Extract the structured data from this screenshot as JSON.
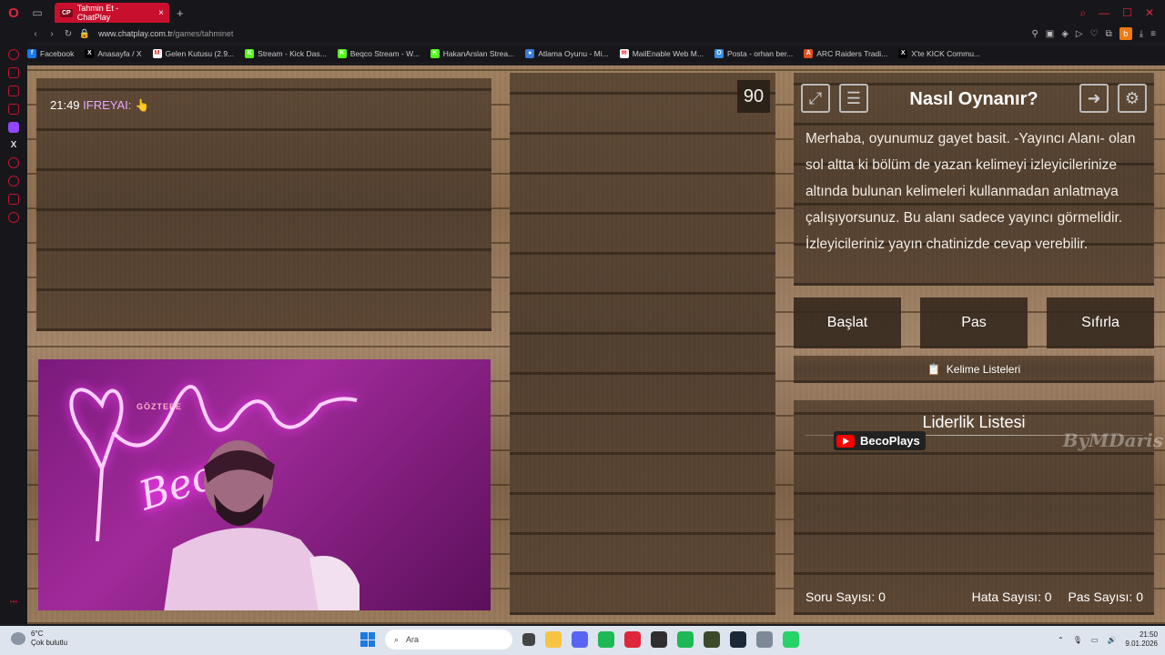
{
  "browser": {
    "tab_title": "Tahmin Et - ChatPlay",
    "tab_favicon": "CP",
    "url_host": "www.chatplay.com.tr",
    "url_path": "/games/tahminet",
    "extension_letter": "b",
    "bookmarks": [
      {
        "label": "Facebook",
        "icon": "facebook-icon",
        "color": "#1877f2",
        "glyph": "f"
      },
      {
        "label": "Anasayfa / X",
        "icon": "x-icon",
        "color": "#000000",
        "glyph": "X"
      },
      {
        "label": "Gelen Kutusu (2.9...",
        "icon": "gmail-icon",
        "color": "#ffffff",
        "glyph": "M"
      },
      {
        "label": "Stream - Kick Das...",
        "icon": "kick-icon",
        "color": "#53fc18",
        "glyph": "K"
      },
      {
        "label": "Beqco Stream - W...",
        "icon": "kick-icon",
        "color": "#53fc18",
        "glyph": "K"
      },
      {
        "label": "HakanArslan Strea...",
        "icon": "kick-icon",
        "color": "#53fc18",
        "glyph": "K"
      },
      {
        "label": "Atlama Oyunu - Mi...",
        "icon": "game-icon",
        "color": "#3a7bd5",
        "glyph": "●"
      },
      {
        "label": "MailEnable Web M...",
        "icon": "mail-icon",
        "color": "#ffffff",
        "glyph": "✉"
      },
      {
        "label": "Posta - orhan ber...",
        "icon": "outlook-icon",
        "color": "#3a8ee6",
        "glyph": "O"
      },
      {
        "label": "ARC Raiders Tradi...",
        "icon": "arc-icon",
        "color": "#e05020",
        "glyph": "A"
      },
      {
        "label": "X'te KICK Commu...",
        "icon": "x-icon",
        "color": "#000000",
        "glyph": "X"
      }
    ]
  },
  "chat": {
    "time": "21:49",
    "user": "IFREYAI:",
    "message": "👆"
  },
  "webcam": {
    "sign_text": "GÖZTEPE",
    "neon_text": "Becc"
  },
  "timer": "90",
  "howto": {
    "title": "Nasıl Oynanır?",
    "text": "Merhaba, oyunumuz gayet basit. -Yayıncı Alanı- olan sol altta ki bölüm de yazan kelimeyi izleyicilerinize altında bulunan kelimeleri kullanmadan anlatmaya çalışıyorsunuz. Bu alanı sadece yayıncı görmelidir. İzleyicileriniz yayın chatinizde cevap verebilir."
  },
  "buttons": {
    "start": "Başlat",
    "pass": "Pas",
    "reset": "Sıfırla",
    "word_lists": "Kelime Listeleri"
  },
  "leaderboard": {
    "title": "Liderlik Listesi",
    "channel": "BecoPlays",
    "signature": "ByMDaris"
  },
  "stats": {
    "questions": "Soru Sayısı: 0",
    "errors": "Hata Sayısı: 0",
    "passes": "Pas Sayısı: 0"
  },
  "taskbar": {
    "weather_temp": "6°C",
    "weather_desc": "Çok bulutlu",
    "weather_badge": "3",
    "search_placeholder": "Ara",
    "time": "21:50",
    "date": "9.01.2026",
    "apps": [
      {
        "name": "file-explorer-icon",
        "color": "#f6c343"
      },
      {
        "name": "discord-icon",
        "color": "#5865f2"
      },
      {
        "name": "spotify-icon",
        "color": "#1db954"
      },
      {
        "name": "opera-icon",
        "color": "#e0263a"
      },
      {
        "name": "obs-icon",
        "color": "#302e31"
      },
      {
        "name": "spotify-icon",
        "color": "#1db954"
      },
      {
        "name": "game-icon",
        "color": "#3c4a2a"
      },
      {
        "name": "steam-icon",
        "color": "#1b2838"
      },
      {
        "name": "app-icon",
        "color": "#7b8a96"
      },
      {
        "name": "whatsapp-icon",
        "color": "#25d366"
      }
    ]
  }
}
